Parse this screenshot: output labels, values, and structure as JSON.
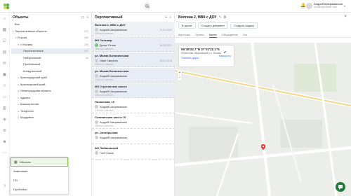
{
  "topbar": {
    "user_name": "Андрей Шахраманьян",
    "user_email": "a.shahr@odiade.com"
  },
  "tree": {
    "title": "Объекты",
    "rows": [
      {
        "label": "Все",
        "count": "",
        "arrow": "",
        "indent": 0
      },
      {
        "label": "Перспективные объекты",
        "count": "370",
        "arrow": "▾",
        "indent": 0
      },
      {
        "label": "Россия",
        "count": "369",
        "arrow": "▾",
        "indent": 1
      },
      {
        "label": "г. Москва",
        "count": "228",
        "arrow": "▾",
        "indent": 2
      },
      {
        "label": "Перспективные",
        "count": "137",
        "arrow": "",
        "indent": 3,
        "selected": true
      },
      {
        "label": "Нейтральный",
        "count": "64",
        "arrow": "",
        "indent": 3
      },
      {
        "label": "Проблемный",
        "count": "",
        "arrow": "",
        "indent": 3
      },
      {
        "label": "Конкурентный",
        "count": "",
        "arrow": "",
        "indent": 3
      },
      {
        "label": "Краснодарский край",
        "count": "",
        "arrow": "▸",
        "indent": 2
      },
      {
        "label": "Красноярский край",
        "count": "",
        "arrow": "▸",
        "indent": 2
      },
      {
        "label": "Ленинградская область",
        "count": "",
        "arrow": "▸",
        "indent": 2
      },
      {
        "label": "Адыгея",
        "count": "",
        "arrow": "▸",
        "indent": 2
      },
      {
        "label": "Башкортостан",
        "count": "",
        "arrow": "▸",
        "indent": 2
      },
      {
        "label": "Татарстан",
        "count": "",
        "arrow": "▸",
        "indent": 2
      },
      {
        "label": "Мордовия",
        "count": "",
        "arrow": "▸",
        "indent": 2
      }
    ]
  },
  "list": {
    "title": "Перспективный",
    "items": [
      {
        "title": "Волгина 2, МВК с ДОУ",
        "user": "Андрей Шахраманьян",
        "date": "10.01.2020",
        "note": "Объект изменен..."
      },
      {
        "title": "ЖК Сильвер",
        "user": "Денис Селин",
        "date": "16.03.2021",
        "note": "Объект изменен..."
      },
      {
        "title": "ул. Малая Ботаническая",
        "user": "Иван Смирнов",
        "date": "25.01.2019",
        "note": "Объект изменен..."
      },
      {
        "title": "ул. Малая Ботаническая",
        "user": "Андрей Шахраманьян",
        "date": "",
        "note": "Объект изменен..."
      },
      {
        "title": "ЖК Строгинское шоссе",
        "user": "Андрей Шахраманьян",
        "date": "",
        "note": "Объект изменен..."
      },
      {
        "title": "Полянская, 10",
        "user": "Андрей Шахраманьян",
        "date": "",
        "note": "Объект изменен..."
      },
      {
        "title": "Головинская шоссе 10",
        "user": "Андрей Шахраманьян",
        "date": "",
        "note": "Объект изменен..."
      },
      {
        "title": "ул. Октябрьская",
        "user": "Андрей Шахраманьян",
        "date": "",
        "note": ""
      },
      {
        "title": "ЖК Лобачевский",
        "user": "Глеб Базин",
        "date": "",
        "note": ""
      }
    ]
  },
  "detail": {
    "title": "Волгина 2, МВК с ДОУ",
    "buttons": [
      "В архив",
      "Создать документ",
      "Создать задачу"
    ],
    "tabs": [
      "Карточка",
      "Проект",
      "Карта",
      "Обсуждение",
      "Лог"
    ],
    "active_tab": 2,
    "map": {
      "coords": "55°38'22.7\"N 37°31'32.1\"E",
      "address": "МОАУСОШ Обручевский р-н, Москва",
      "link": "Показать адрес",
      "route": "Маршруты"
    }
  },
  "popup": {
    "items": [
      "Объекты",
      "Замечания",
      "ПО",
      "Проблемы"
    ],
    "active": 0
  },
  "colors": {
    "accent": "#3a6fd8",
    "selection": "#e8ecf3",
    "chat_button": "#1f7a3c",
    "popup_active_border": "#8bc34a"
  }
}
